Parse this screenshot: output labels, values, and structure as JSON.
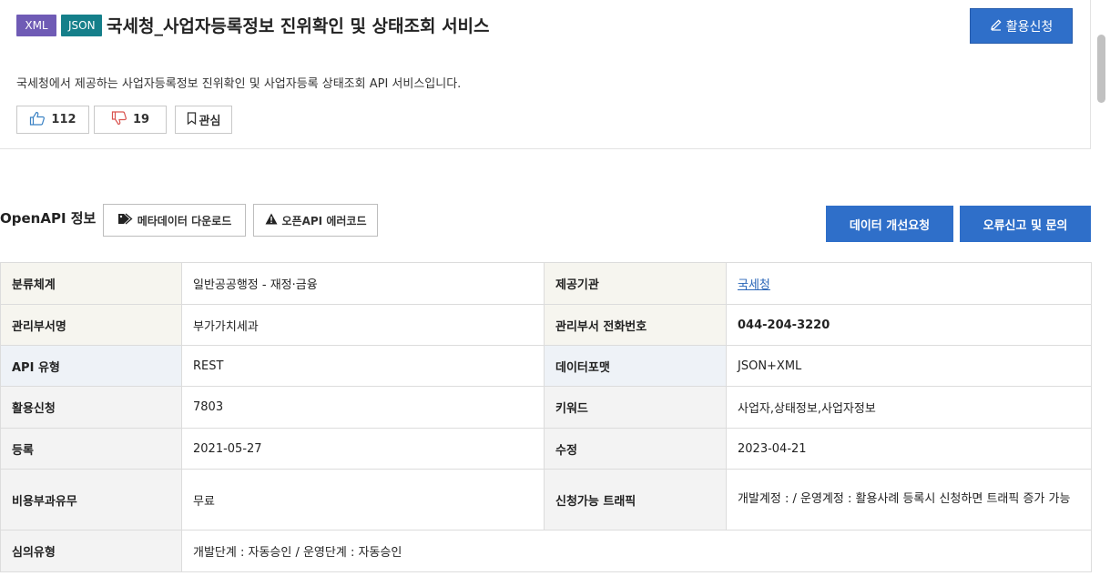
{
  "header": {
    "badges": [
      "XML",
      "JSON"
    ],
    "title": "국세청_사업자등록정보 진위확인 및 상태조회 서비스",
    "apply_label": "활용신청",
    "apply_icon": "pencil-icon",
    "description": "국세청에서 제공하는 사업자등록정보 진위확인 및 사업자등록 상태조회 API 서비스입니다.",
    "likes": "112",
    "dislikes": "19",
    "bookmark_label": "관심"
  },
  "openapi": {
    "title": "OpenAPI 정보",
    "metadata_download_label": "메타데이터 다운로드",
    "error_code_label": "오픈API 에러코드",
    "improve_request_label": "데이터 개선요청",
    "report_label": "오류신고 및 문의"
  },
  "info_table": {
    "rows": [
      {
        "k1": "분류체계",
        "v1": "일반공공행정 - 재정·금융",
        "k2": "제공기관",
        "v2": "국세청"
      },
      {
        "k1": "관리부서명",
        "v1": "부가가치세과",
        "k2": "관리부서 전화번호",
        "v2": "044-204-3220"
      },
      {
        "k1": "API 유형",
        "v1": "REST",
        "k2": "데이터포맷",
        "v2": "JSON+XML"
      },
      {
        "k1": "활용신청",
        "v1": "7803",
        "k2": "키워드",
        "v2": "사업자,상태정보,사업자정보"
      },
      {
        "k1": "등록",
        "v1": "2021-05-27",
        "k2": "수정",
        "v2": "2023-04-21"
      },
      {
        "k1": "비용부과유무",
        "v1": "무료",
        "k2": "신청가능 트래픽",
        "v2": "개발계정 : / 운영계정 : 활용사례 등록시 신청하면 트래픽 증가 가능"
      },
      {
        "k1": "심의유형",
        "v1": "개발단계 : 자동승인 / 운영단계 : 자동승인"
      }
    ]
  },
  "colors": {
    "primary_button": "#2f6fc9",
    "badge_xml": "#6f5bb5",
    "badge_json": "#157f8a",
    "link": "#2a66b8"
  }
}
